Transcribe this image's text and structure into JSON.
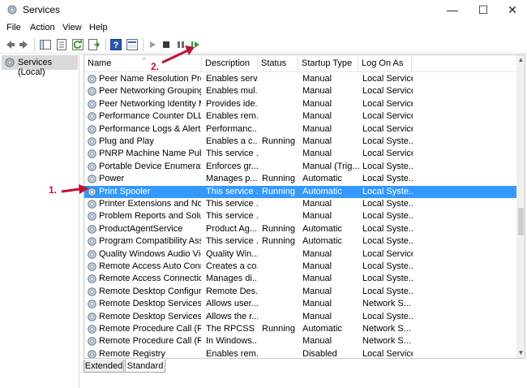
{
  "window": {
    "title": "Services",
    "min_glyph": "—",
    "max_glyph": "☐",
    "close_glyph": "✕"
  },
  "menu": [
    "File",
    "Action",
    "View",
    "Help"
  ],
  "tree": {
    "root_label": "Services (Local)"
  },
  "columns": [
    "Name",
    "Description",
    "Status",
    "Startup Type",
    "Log On As"
  ],
  "services": [
    {
      "name": "Peer Name Resolution Prot...",
      "description": "Enables serv...",
      "status": "",
      "startup": "Manual",
      "logon": "Local Service"
    },
    {
      "name": "Peer Networking Grouping",
      "description": "Enables mul...",
      "status": "",
      "startup": "Manual",
      "logon": "Local Service"
    },
    {
      "name": "Peer Networking Identity M...",
      "description": "Provides ide...",
      "status": "",
      "startup": "Manual",
      "logon": "Local Service"
    },
    {
      "name": "Performance Counter DLL ...",
      "description": "Enables rem...",
      "status": "",
      "startup": "Manual",
      "logon": "Local Service"
    },
    {
      "name": "Performance Logs & Alerts",
      "description": "Performanc...",
      "status": "",
      "startup": "Manual",
      "logon": "Local Service"
    },
    {
      "name": "Plug and Play",
      "description": "Enables a c...",
      "status": "Running",
      "startup": "Manual",
      "logon": "Local Syste..."
    },
    {
      "name": "PNRP Machine Name Publi...",
      "description": "This service ...",
      "status": "",
      "startup": "Manual",
      "logon": "Local Service"
    },
    {
      "name": "Portable Device Enumerator...",
      "description": "Enforces gr...",
      "status": "",
      "startup": "Manual (Trig...",
      "logon": "Local Syste..."
    },
    {
      "name": "Power",
      "description": "Manages p...",
      "status": "Running",
      "startup": "Automatic",
      "logon": "Local Syste..."
    },
    {
      "name": "Print Spooler",
      "description": "This service ...",
      "status": "Running",
      "startup": "Automatic",
      "logon": "Local Syste...",
      "selected": true
    },
    {
      "name": "Printer Extensions and Notif...",
      "description": "This service ...",
      "status": "",
      "startup": "Manual",
      "logon": "Local Syste..."
    },
    {
      "name": "Problem Reports and Soluti...",
      "description": "This service ...",
      "status": "",
      "startup": "Manual",
      "logon": "Local Syste..."
    },
    {
      "name": "ProductAgentService",
      "description": "Product Ag...",
      "status": "Running",
      "startup": "Automatic",
      "logon": "Local Syste..."
    },
    {
      "name": "Program Compatibility Assi...",
      "description": "This service ...",
      "status": "Running",
      "startup": "Automatic",
      "logon": "Local Syste..."
    },
    {
      "name": "Quality Windows Audio Vid...",
      "description": "Quality Win...",
      "status": "",
      "startup": "Manual",
      "logon": "Local Service"
    },
    {
      "name": "Remote Access Auto Conne...",
      "description": "Creates a co...",
      "status": "",
      "startup": "Manual",
      "logon": "Local Syste..."
    },
    {
      "name": "Remote Access Connection...",
      "description": "Manages di...",
      "status": "",
      "startup": "Manual",
      "logon": "Local Syste..."
    },
    {
      "name": "Remote Desktop Configurat...",
      "description": "Remote Des...",
      "status": "",
      "startup": "Manual",
      "logon": "Local Syste..."
    },
    {
      "name": "Remote Desktop Services",
      "description": "Allows user...",
      "status": "",
      "startup": "Manual",
      "logon": "Network S..."
    },
    {
      "name": "Remote Desktop Services U...",
      "description": "Allows the r...",
      "status": "",
      "startup": "Manual",
      "logon": "Local Syste..."
    },
    {
      "name": "Remote Procedure Call (RPC)",
      "description": "The RPCSS ...",
      "status": "Running",
      "startup": "Automatic",
      "logon": "Network S..."
    },
    {
      "name": "Remote Procedure Call (RP...",
      "description": "In Windows...",
      "status": "",
      "startup": "Manual",
      "logon": "Network S..."
    },
    {
      "name": "Remote Registry",
      "description": "Enables rem...",
      "status": "",
      "startup": "Disabled",
      "logon": "Local Service"
    }
  ],
  "tabs": [
    "Extended",
    "Standard"
  ],
  "annotations": {
    "step1": "1.",
    "step2": "2."
  },
  "colors": {
    "selection": "#3399ff",
    "annotation": "#c0123c",
    "play_green": "#3a9a3a"
  }
}
